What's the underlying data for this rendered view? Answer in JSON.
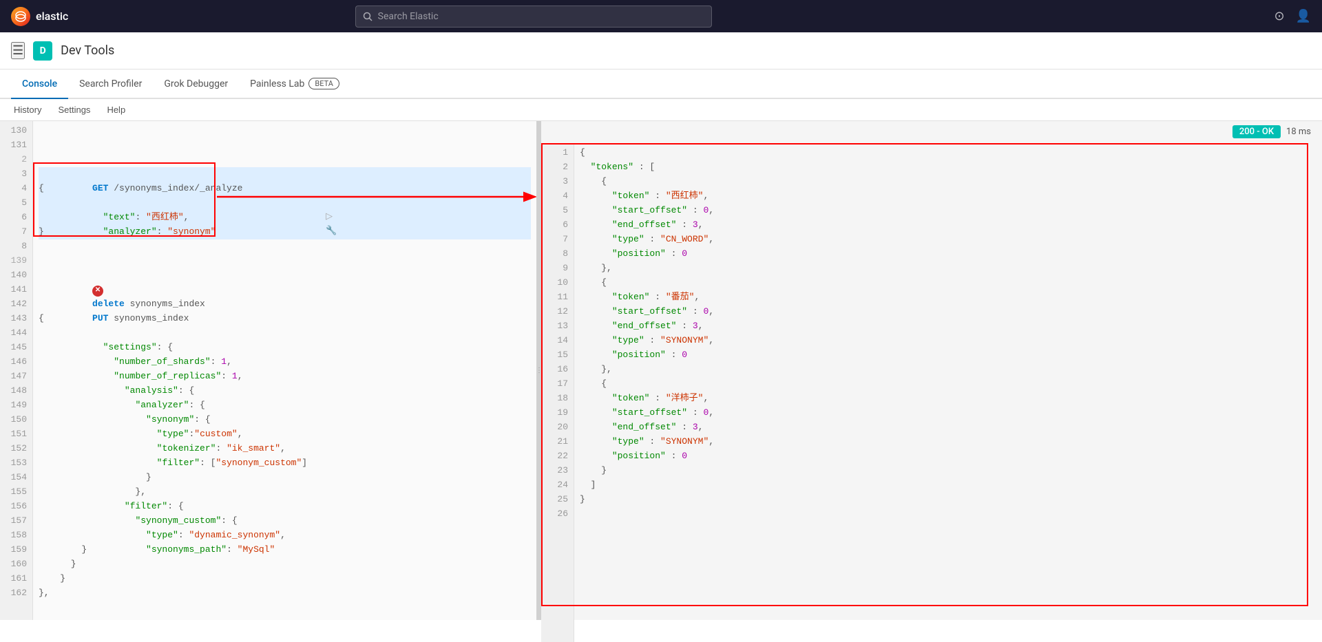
{
  "topbar": {
    "logo_text": "elastic",
    "logo_letter": "e",
    "search_placeholder": "Search Elastic",
    "search_icon": "search-icon"
  },
  "appbar": {
    "menu_icon": "≡",
    "app_letter": "D",
    "app_title": "Dev Tools"
  },
  "tabs": [
    {
      "id": "console",
      "label": "Console",
      "active": true
    },
    {
      "id": "search-profiler",
      "label": "Search Profiler",
      "active": false
    },
    {
      "id": "grok-debugger",
      "label": "Grok Debugger",
      "active": false
    },
    {
      "id": "painless-lab",
      "label": "Painless Lab",
      "active": false,
      "beta": true
    }
  ],
  "beta_badge": "BETA",
  "toolbar": {
    "history": "History",
    "settings": "Settings",
    "help": "Help"
  },
  "status": {
    "code": "200 - OK",
    "time": "18 ms"
  },
  "editor": {
    "lines": [
      {
        "num": "130",
        "content": ""
      },
      {
        "num": "131",
        "content": ""
      },
      {
        "num": "2",
        "content": ""
      },
      {
        "num": "3",
        "content": "GET /synonyms_index/_analyze",
        "highlight": true,
        "class": "get-line"
      },
      {
        "num": "4",
        "content": "{",
        "highlight": true
      },
      {
        "num": "5",
        "content": "  \"text\": \"西红柿\",",
        "highlight": true
      },
      {
        "num": "6",
        "content": "  \"analyzer\": \"synonym\"",
        "highlight": true
      },
      {
        "num": "7",
        "content": "}",
        "highlight": true
      },
      {
        "num": "8",
        "content": ""
      },
      {
        "num": "139",
        "content": ""
      },
      {
        "num": "140",
        "content": "delete synonyms_index",
        "error": true
      },
      {
        "num": "141",
        "content": ""
      },
      {
        "num": "142",
        "content": "PUT synonyms_index"
      },
      {
        "num": "143",
        "content": "{"
      },
      {
        "num": "144",
        "content": "  \"settings\": {"
      },
      {
        "num": "145",
        "content": "    \"number_of_shards\": 1,"
      },
      {
        "num": "146",
        "content": "    \"number_of_replicas\": 1,"
      },
      {
        "num": "147",
        "content": "    \"analysis\": {"
      },
      {
        "num": "148",
        "content": "      \"analyzer\": {"
      },
      {
        "num": "149",
        "content": "        \"synonym\": {"
      },
      {
        "num": "150",
        "content": "          \"type\":\"custom\","
      },
      {
        "num": "151",
        "content": "          \"tokenizer\": \"ik_smart\","
      },
      {
        "num": "152",
        "content": "          \"filter\": [\"synonym_custom\"]"
      },
      {
        "num": "153",
        "content": "        }"
      },
      {
        "num": "154",
        "content": "      },"
      },
      {
        "num": "155",
        "content": "      \"filter\": {"
      },
      {
        "num": "156",
        "content": "        \"synonym_custom\": {"
      },
      {
        "num": "157",
        "content": "          \"type\": \"dynamic_synonym\","
      },
      {
        "num": "158",
        "content": "          \"synonyms_path\": \"MySql\""
      },
      {
        "num": "159",
        "content": "        }"
      },
      {
        "num": "160",
        "content": "      }"
      },
      {
        "num": "161",
        "content": "    }"
      },
      {
        "num": "162",
        "content": "},"
      }
    ]
  },
  "output": {
    "lines": [
      {
        "num": "1",
        "content": "{"
      },
      {
        "num": "2",
        "content": "  \"tokens\" : ["
      },
      {
        "num": "3",
        "content": "    {"
      },
      {
        "num": "4",
        "content": "      \"token\" : \"西红柿\","
      },
      {
        "num": "5",
        "content": "      \"start_offset\" : 0,"
      },
      {
        "num": "6",
        "content": "      \"end_offset\" : 3,"
      },
      {
        "num": "7",
        "content": "      \"type\" : \"CN_WORD\","
      },
      {
        "num": "8",
        "content": "      \"position\" : 0"
      },
      {
        "num": "9",
        "content": "    },"
      },
      {
        "num": "10",
        "content": "    {"
      },
      {
        "num": "11",
        "content": "      \"token\" : \"番茄\","
      },
      {
        "num": "12",
        "content": "      \"start_offset\" : 0,"
      },
      {
        "num": "13",
        "content": "      \"end_offset\" : 3,"
      },
      {
        "num": "14",
        "content": "      \"type\" : \"SYNONYM\","
      },
      {
        "num": "15",
        "content": "      \"position\" : 0"
      },
      {
        "num": "16",
        "content": "    },"
      },
      {
        "num": "17",
        "content": "    {"
      },
      {
        "num": "18",
        "content": "      \"token\" : \"洋柿子\","
      },
      {
        "num": "19",
        "content": "      \"start_offset\" : 0,"
      },
      {
        "num": "20",
        "content": "      \"end_offset\" : 3,"
      },
      {
        "num": "21",
        "content": "      \"type\" : \"SYNONYM\","
      },
      {
        "num": "22",
        "content": "      \"position\" : 0"
      },
      {
        "num": "23",
        "content": "    }"
      },
      {
        "num": "24",
        "content": "  ]"
      },
      {
        "num": "25",
        "content": "}"
      },
      {
        "num": "26",
        "content": ""
      }
    ]
  }
}
